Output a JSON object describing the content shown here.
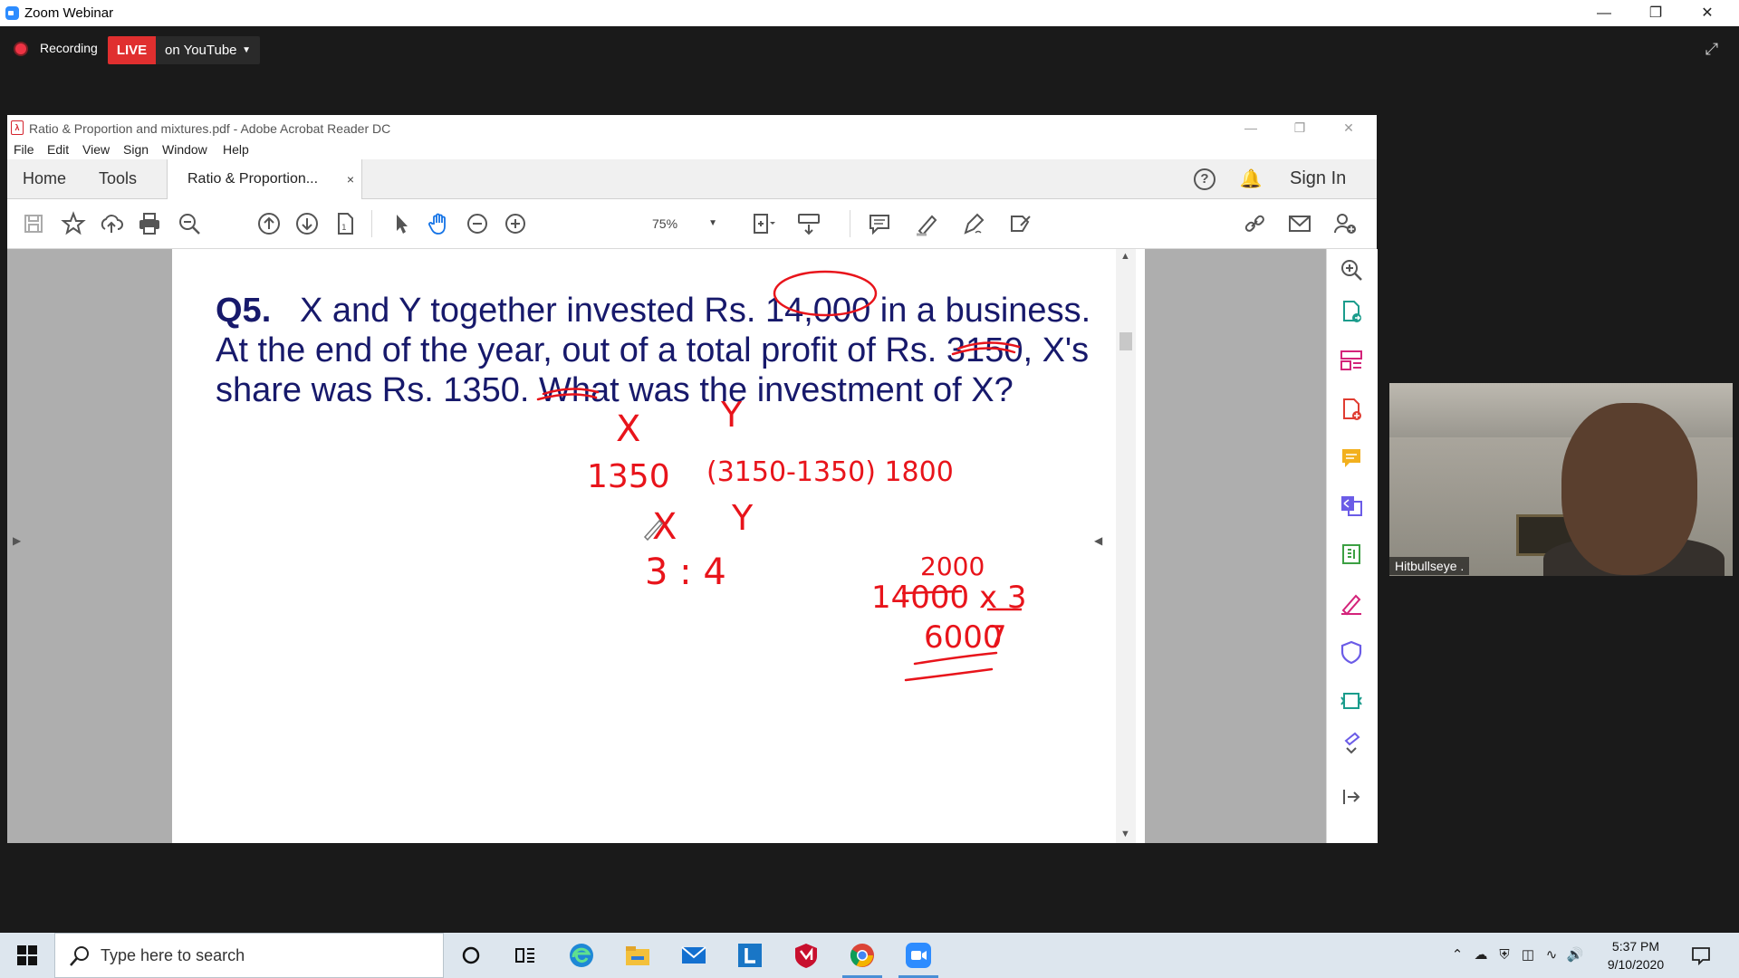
{
  "zoom": {
    "window_title": "Zoom Webinar",
    "recording_label": "Recording",
    "live_badge": "LIVE",
    "live_destination": "on YouTube"
  },
  "acrobat": {
    "window_title": "Ratio & Proportion and mixtures.pdf - Adobe Acrobat Reader DC",
    "menu": [
      "File",
      "Edit",
      "View",
      "Sign",
      "Window",
      "Help"
    ],
    "tabs": {
      "home": "Home",
      "tools": "Tools",
      "document": "Ratio & Proportion...",
      "close": "×"
    },
    "sign_in": "Sign In",
    "zoom_level": "75%"
  },
  "document": {
    "question_number": "Q5.",
    "question_line1": "X and Y together invested Rs. 14,000 in a business.",
    "question_line2": "At the end of the year, out of a total profit of Rs. 3150, X's",
    "question_line3": "share was Rs. 1350. What was the investment of X?",
    "handwriting": {
      "x_label": "X",
      "y_label": "Y",
      "x_value": "1350",
      "y_value": "(3150-1350) 1800",
      "ratio": "3 : 4",
      "calc_top": "2000",
      "calc": "14000 x 3",
      "calc_denominator": "7",
      "answer": "6000"
    }
  },
  "participant": {
    "name": "Hitbullseye ."
  },
  "taskbar": {
    "search_placeholder": "Type here to search",
    "time": "5:37 PM",
    "date": "9/10/2020"
  },
  "colors": {
    "question_text": "#17196b",
    "ink": "#e8141b",
    "live": "#e02f2f",
    "zoom_blue": "#2d8cff"
  }
}
